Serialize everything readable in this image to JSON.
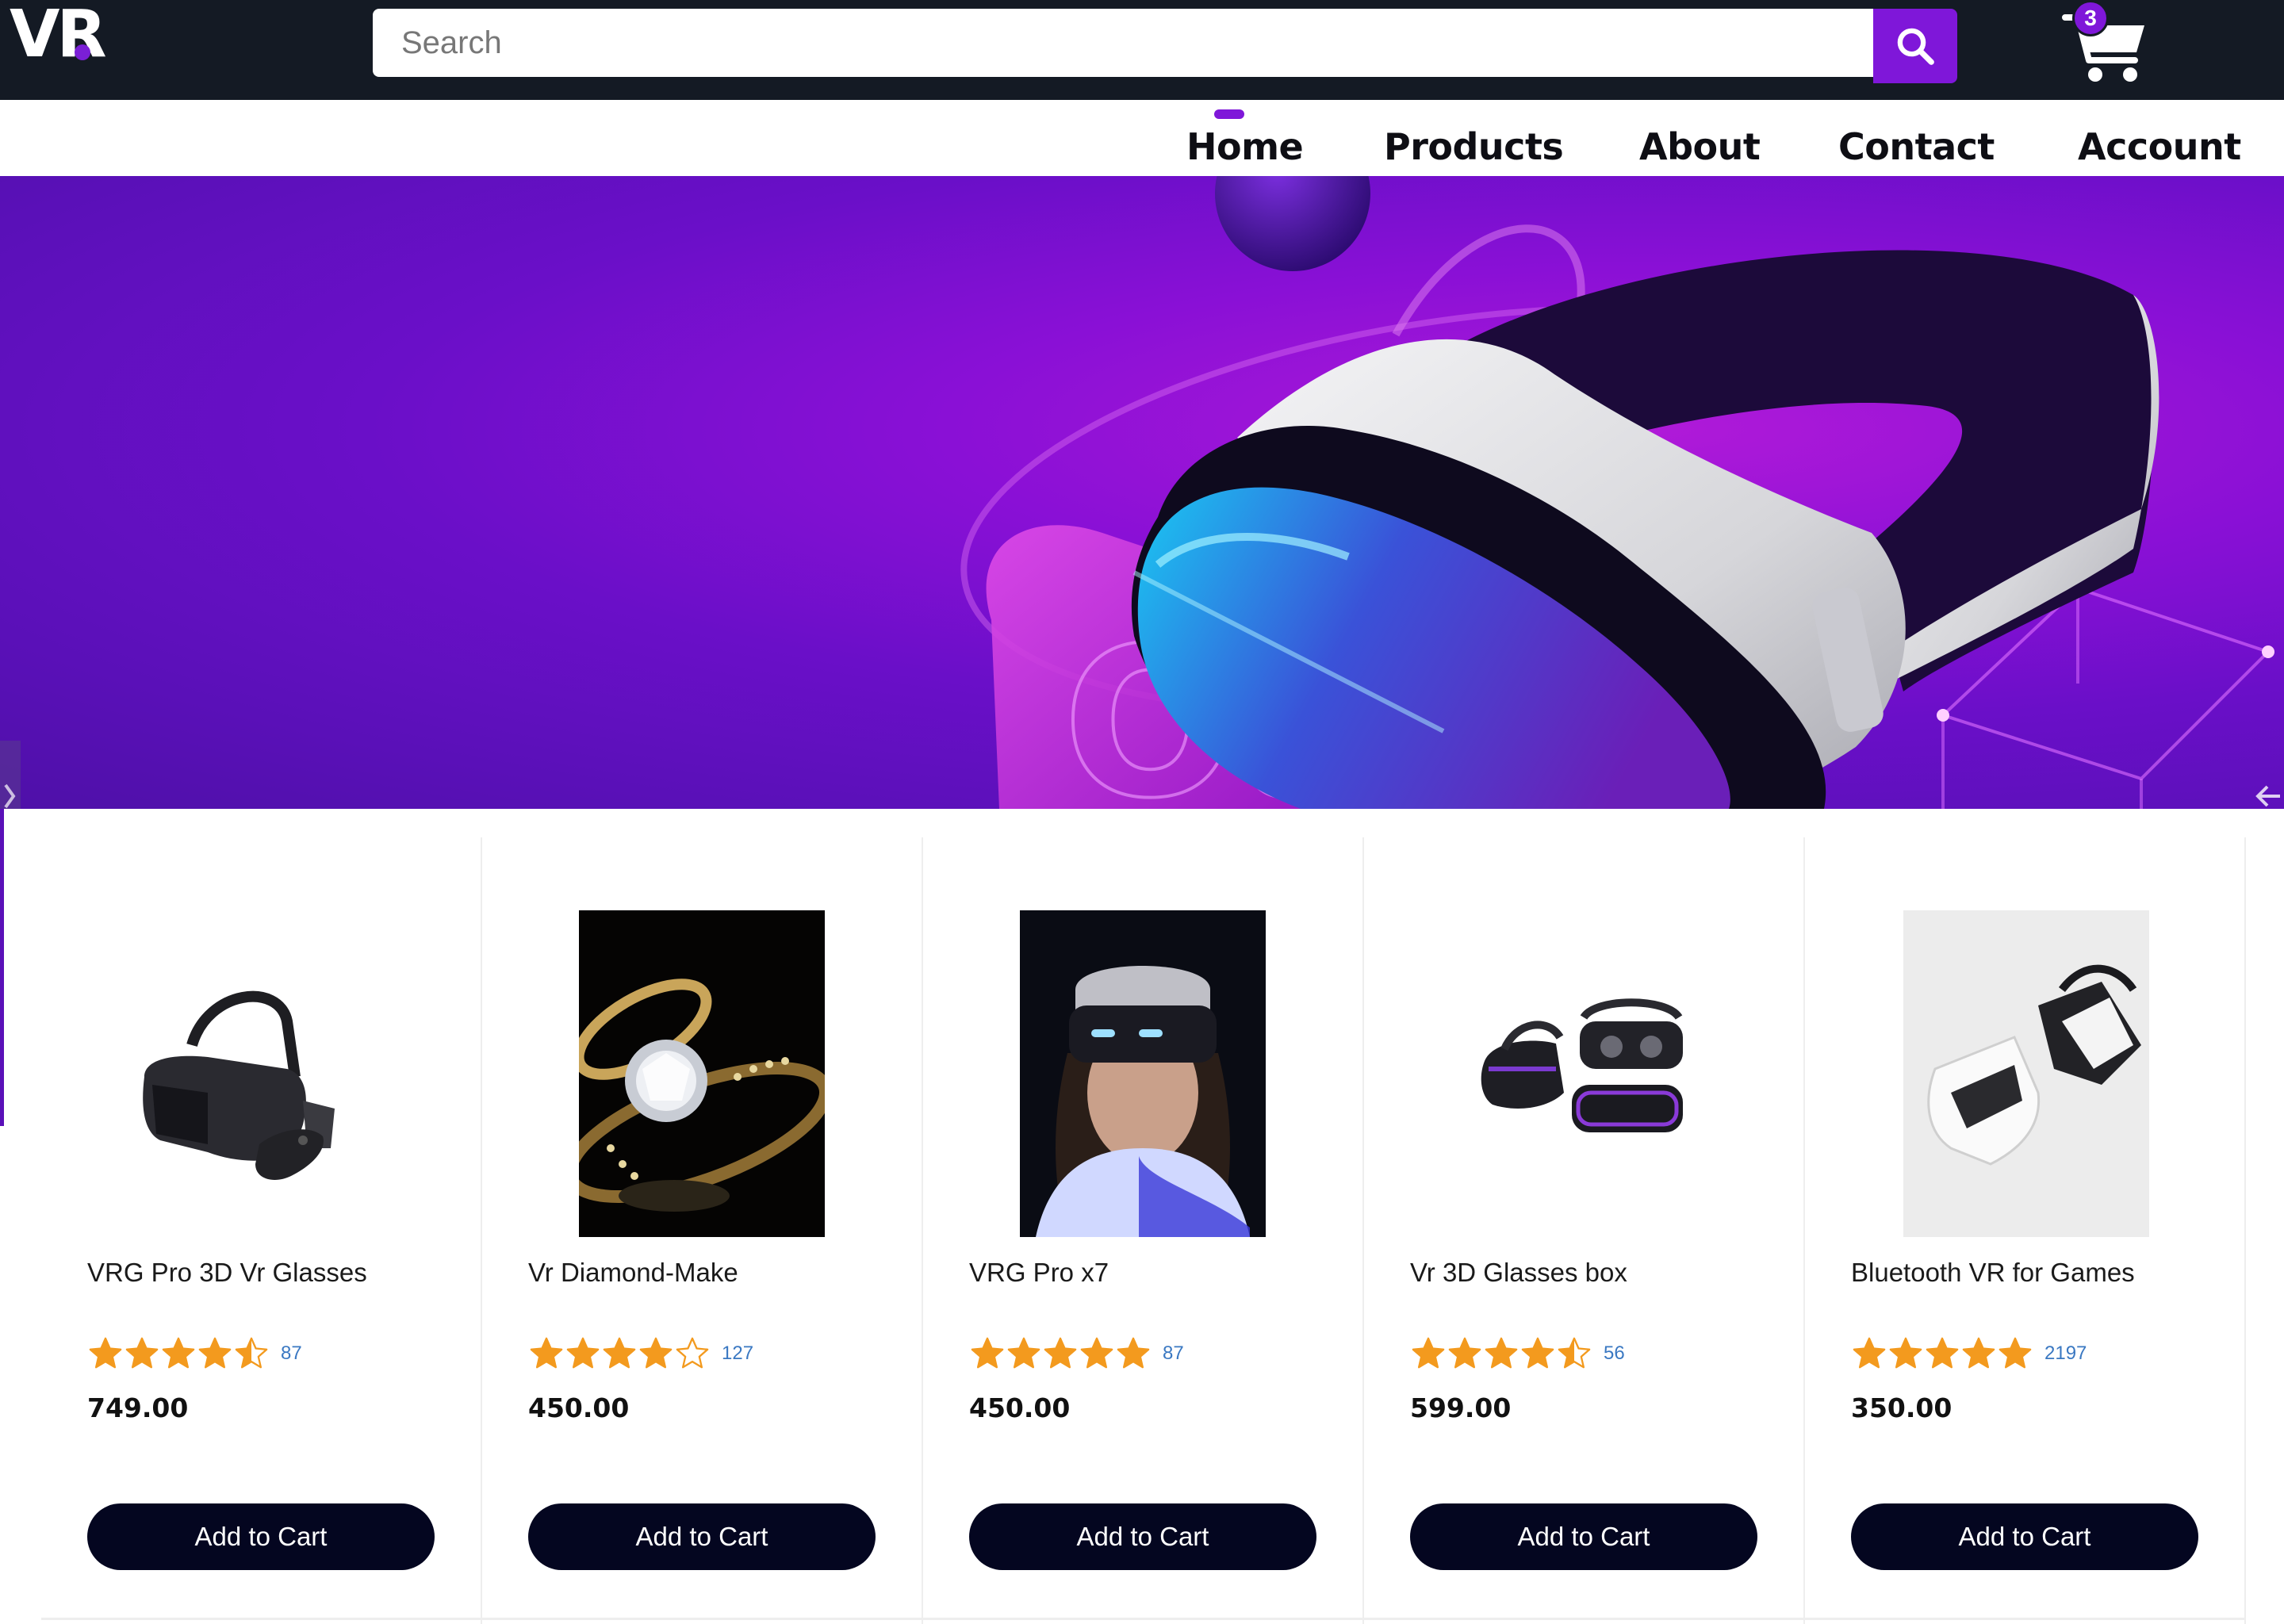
{
  "header": {
    "logo": "VR",
    "search_placeholder": "Search",
    "cart_count": "3",
    "icons": {
      "search": "search-icon",
      "cart": "cart-icon"
    }
  },
  "nav": {
    "items": [
      "Home",
      "Products",
      "About",
      "Contact",
      "Account"
    ],
    "active": "Home"
  },
  "hero": {
    "background_text": "Oas",
    "icons": {
      "prev": "chevron-left-icon",
      "next": "arrow-left-icon"
    }
  },
  "products": [
    {
      "name": "VRG Pro 3D Vr Glasses",
      "rating": 4.5,
      "reviews": "87",
      "price": "749.00",
      "button": "Add to Cart"
    },
    {
      "name": "Vr Diamond-Make",
      "rating": 4,
      "reviews": "127",
      "price": "450.00",
      "button": "Add to Cart"
    },
    {
      "name": "VRG Pro x7",
      "rating": 5,
      "reviews": "87",
      "price": "450.00",
      "button": "Add to Cart"
    },
    {
      "name": "Vr 3D Glasses box",
      "rating": 4.5,
      "reviews": "56",
      "price": "599.00",
      "button": "Add to Cart"
    },
    {
      "name": "Bluetooth VR for Games",
      "rating": 5,
      "reviews": "2197",
      "price": "350.00",
      "button": "Add to Cart"
    }
  ],
  "colors": {
    "accent": "#7f17d9",
    "topbar": "#141a24",
    "star": "#f39a1e",
    "button": "#040620",
    "review_count": "#3a78c2"
  }
}
